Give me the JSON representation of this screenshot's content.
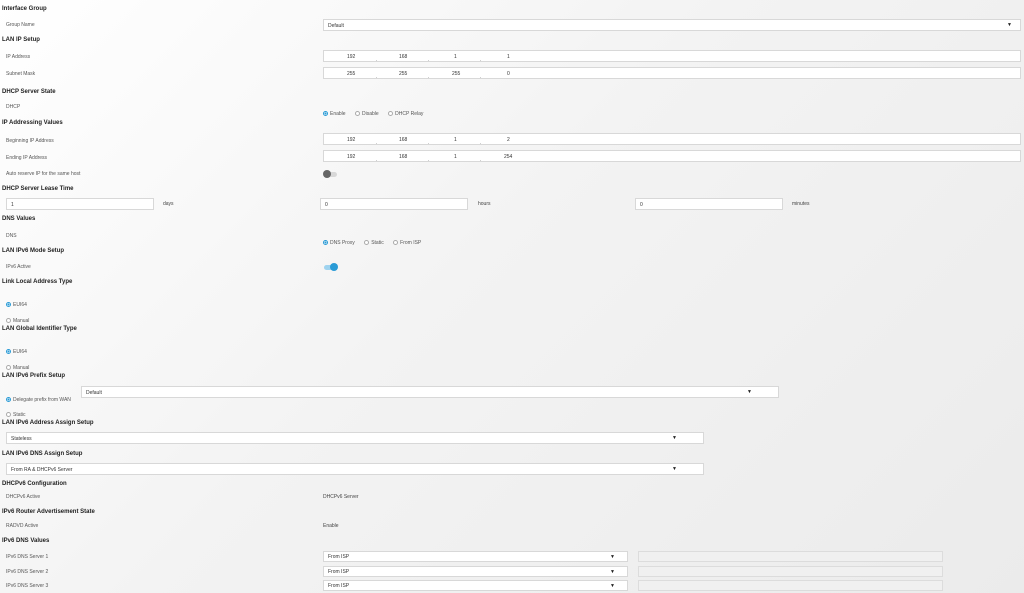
{
  "interface_group": {
    "heading": "Interface Group",
    "group_name_label": "Group Name",
    "group_name_value": "Default"
  },
  "lan_ip": {
    "heading": "LAN IP Setup",
    "ip_label": "IP Address",
    "ip": [
      "192",
      "168",
      "1",
      "1"
    ],
    "mask_label": "Subnet Mask",
    "mask": [
      "255",
      "255",
      "255",
      "0"
    ]
  },
  "dhcp_state": {
    "heading": "DHCP Server State",
    "label": "DHCP",
    "options": [
      "Enable",
      "Disable",
      "DHCP Relay"
    ],
    "selected": "Enable"
  },
  "ip_addressing": {
    "heading": "IP Addressing Values",
    "begin_label": "Beginning IP Address",
    "begin": [
      "192",
      "168",
      "1",
      "2"
    ],
    "end_label": "Ending IP Address",
    "end": [
      "192",
      "168",
      "1",
      "254"
    ],
    "reserve_label": "Auto reserve IP for the same host",
    "reserve_enabled": false
  },
  "lease": {
    "heading": "DHCP Server Lease Time",
    "days_value": "1",
    "days_unit": "days",
    "hours_value": "0",
    "hours_unit": "hours",
    "minutes_value": "0",
    "minutes_unit": "minutes"
  },
  "dns": {
    "heading": "DNS Values",
    "label": "DNS",
    "options": [
      "DNS Proxy",
      "Static",
      "From ISP"
    ],
    "selected": "DNS Proxy"
  },
  "ipv6_mode": {
    "heading": "LAN IPv6 Mode Setup",
    "label": "IPv6 Active",
    "enabled": true
  },
  "link_local": {
    "heading": "Link Local Address Type",
    "options": [
      "EUI64",
      "Manual"
    ],
    "selected": "EUI64"
  },
  "global_id": {
    "heading": "LAN Global Identifier Type",
    "options": [
      "EUI64",
      "Manual"
    ],
    "selected": "EUI64"
  },
  "prefix": {
    "heading": "LAN IPv6 Prefix Setup",
    "delegate_label": "Delegate prefix from WAN",
    "delegate_value": "Default",
    "static_label": "Static",
    "selected": "Delegate prefix from WAN"
  },
  "assign": {
    "heading": "LAN IPv6 Address Assign Setup",
    "value": "Stateless"
  },
  "dns_assign": {
    "heading": "LAN IPv6 DNS Assign Setup",
    "value": "From RA & DHCPv6 Server"
  },
  "dhcpv6": {
    "heading": "DHCPv6 Configuration",
    "label": "DHCPv6 Active",
    "value": "DHCPv6 Server"
  },
  "router_adv": {
    "heading": "IPv6 Router Advertisement State",
    "label": "RADVD Active",
    "value": "Enable"
  },
  "ipv6_dns": {
    "heading": "IPv6 DNS Values",
    "servers": [
      {
        "label": "IPv6 DNS Server 1",
        "value": "From ISP"
      },
      {
        "label": "IPv6 DNS Server 2",
        "value": "From ISP"
      },
      {
        "label": "IPv6 DNS Server 3",
        "value": "From ISP"
      }
    ]
  },
  "icons": {
    "dropdown": "caret-down-icon",
    "radio": "radio-button",
    "toggle": "toggle-switch"
  },
  "colors": {
    "accent": "#2a9bd6",
    "toggle_off": "#666666"
  }
}
